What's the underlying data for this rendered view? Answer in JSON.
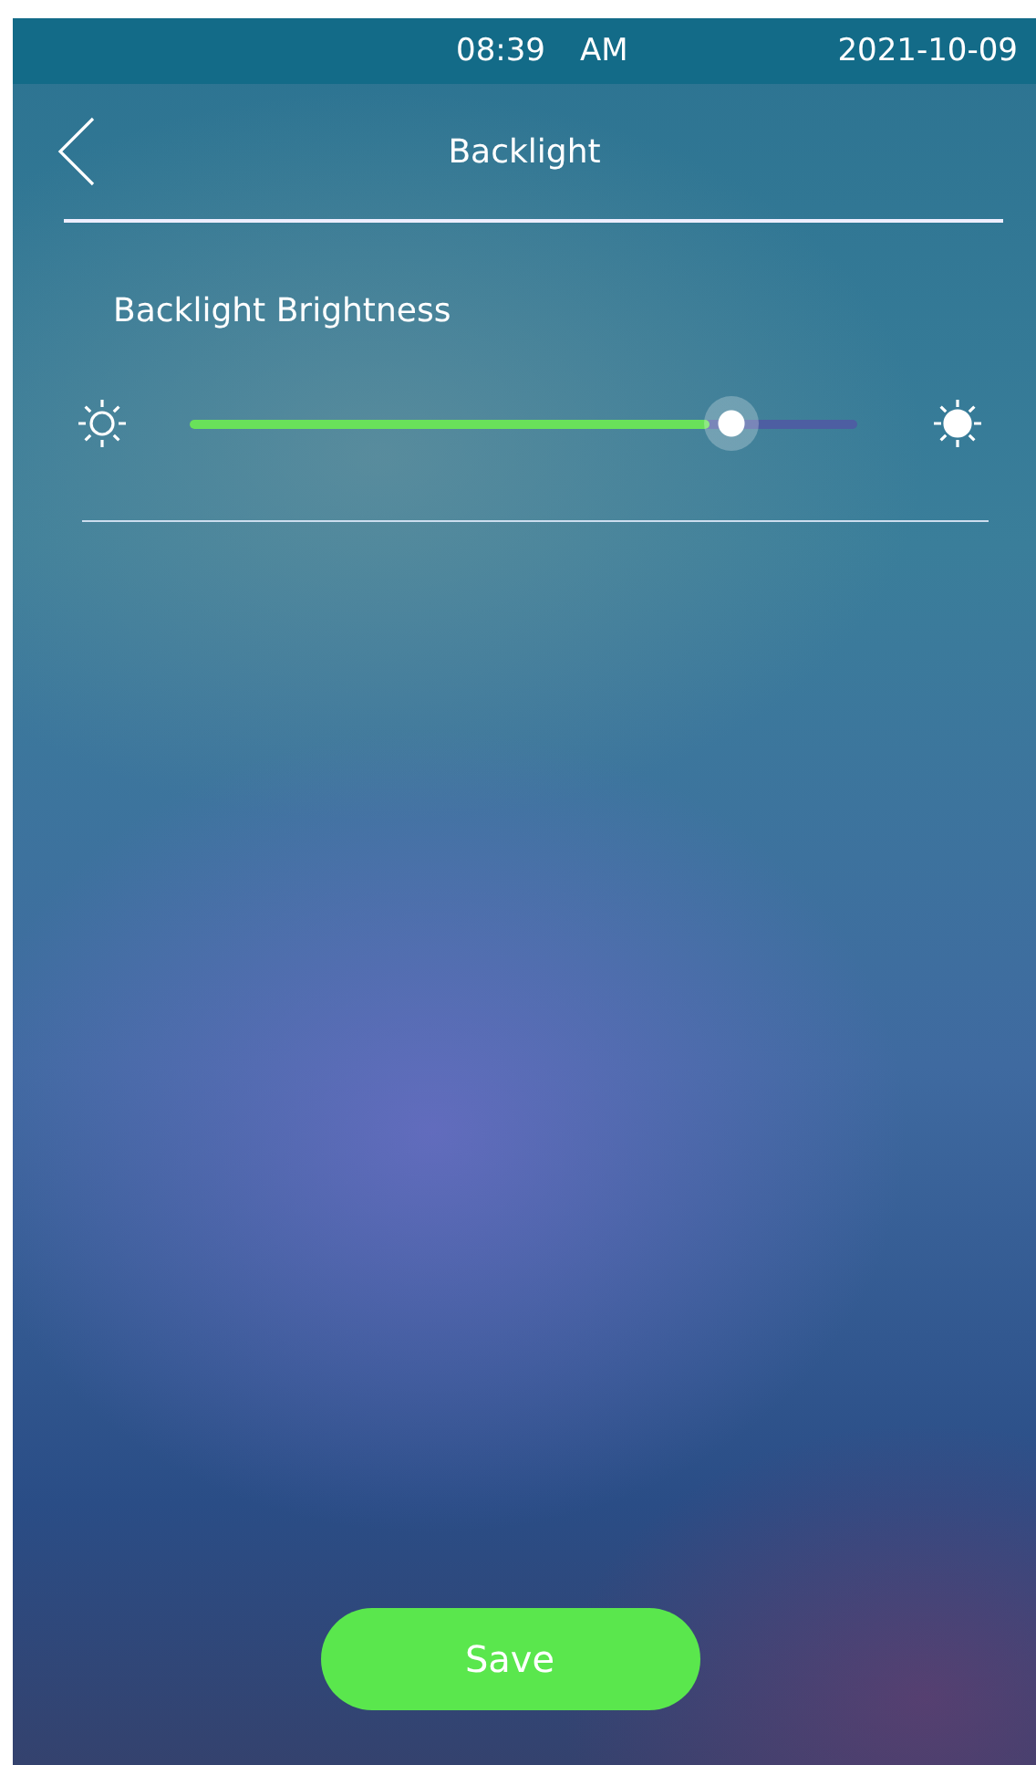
{
  "status_bar": {
    "time": "08:39",
    "meridiem": "AM",
    "date": "2021-10-09"
  },
  "header": {
    "title": "Backlight"
  },
  "setting": {
    "label": "Backlight Brightness",
    "level": 0.78
  },
  "buttons": [
    {
      "label": "Save"
    }
  ]
}
